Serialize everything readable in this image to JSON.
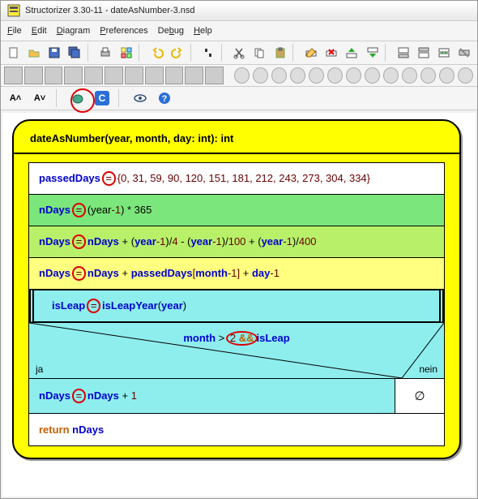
{
  "title": "Structorizer 3.30-11 - dateAsNumber-3.nsd",
  "menu": {
    "file": "File",
    "edit": "Edit",
    "diagram": "Diagram",
    "preferences": "Preferences",
    "debug": "Debug",
    "help": "Help"
  },
  "tb3": {
    "a_up": "A˄",
    "a_dn": "A˅"
  },
  "nsd": {
    "header": "dateAsNumber(year, month, day: int): int",
    "r1_a": "passedDays",
    "r1_eq": "=",
    "r1_b": "{0, 31, 59, 90, 120, 151, 181, 212, 243, 273, 304, 334}",
    "r2_a": "nDays",
    "r2_eq": "=",
    "r2_b": "(year",
    "r2_c": "-1",
    "r2_d": ") * 365",
    "r3_a": "nDays",
    "r3_eq": "=",
    "r3_b": "nDays",
    "r3_c": " + (",
    "r3_d": "year",
    "r3_e": "-1",
    "r3_f": ")/",
    "r3_g": "4",
    "r3_h": " - (",
    "r3_i": "year",
    "r3_j": "-1",
    "r3_k": ")/",
    "r3_l": "100",
    "r3_m": " + (",
    "r3_n": "year",
    "r3_o": "-1",
    "r3_p": ")/",
    "r3_q": "400",
    "r4_a": "nDays",
    "r4_eq": "=",
    "r4_b": "nDays",
    "r4_c": " + ",
    "r4_d": "passedDays",
    "r4_e": "[",
    "r4_f": "month",
    "r4_g": "-1",
    "r4_h": "]",
    " r4_i": " + ",
    "r4_j": "day",
    "r4_k": "-1",
    "r5_a": "isLeap",
    "r5_eq": "=",
    "r5_b": "isLeapYear",
    "r5_c": "(",
    "r5_d": "year",
    "r5_e": ")",
    "cond_a": "month",
    "cond_b": " > ",
    "cond_c": "2",
    "cond_d": " && ",
    "cond_e": "isLeap",
    "ja": "ja",
    "nein": "nein",
    "then_a": "nDays",
    "then_eq": "=",
    "then_b": "nDays",
    "then_c": " + 1",
    "else": "∅",
    "ret_a": "return",
    "ret_b": " nDays"
  }
}
